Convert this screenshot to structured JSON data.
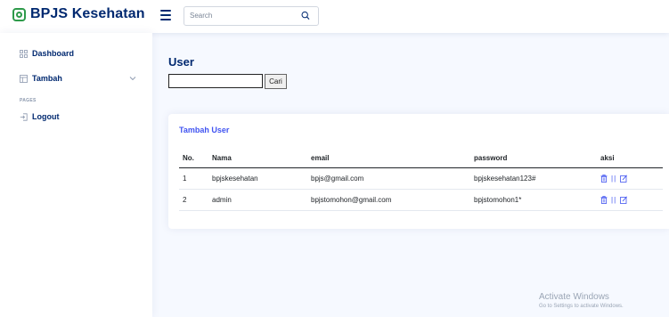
{
  "brand": {
    "name": "BPJS Kesehatan",
    "icon": "bpjs-logo-icon"
  },
  "header": {
    "menu_icon": "hamburger-icon",
    "search_placeholder": "Search",
    "search_icon": "search-icon"
  },
  "sidebar": {
    "items": [
      {
        "label": "Dashboard",
        "icon": "grid-icon"
      },
      {
        "label": "Tambah",
        "icon": "layout-icon",
        "chevron": "chevron-down-icon"
      },
      {
        "label": "Logout",
        "icon": "logout-icon"
      }
    ],
    "heading": "PAGES"
  },
  "main": {
    "title": "User",
    "find_value": "",
    "find_button": "Cari",
    "card": {
      "title": "Tambah User",
      "columns": [
        "No.",
        "Nama",
        "email",
        "password",
        "aksi"
      ],
      "rows": [
        {
          "no": "1",
          "nama": "bpjskesehatan",
          "email": "bpjs@gmail.com",
          "password": "bpjskesehatan123#",
          "sep": "||"
        },
        {
          "no": "2",
          "nama": "admin",
          "email": "bpjstomohon@gmail.com",
          "password": "bpjstomohon1*",
          "sep": "||"
        }
      ]
    }
  },
  "watermark": {
    "line1": "Activate Windows",
    "line2": "Go to Settings to activate Windows."
  },
  "colors": {
    "navy": "#012970",
    "accent": "#4154f1",
    "logo_green": "#2e9a4a",
    "background": "#f6f9ff"
  }
}
